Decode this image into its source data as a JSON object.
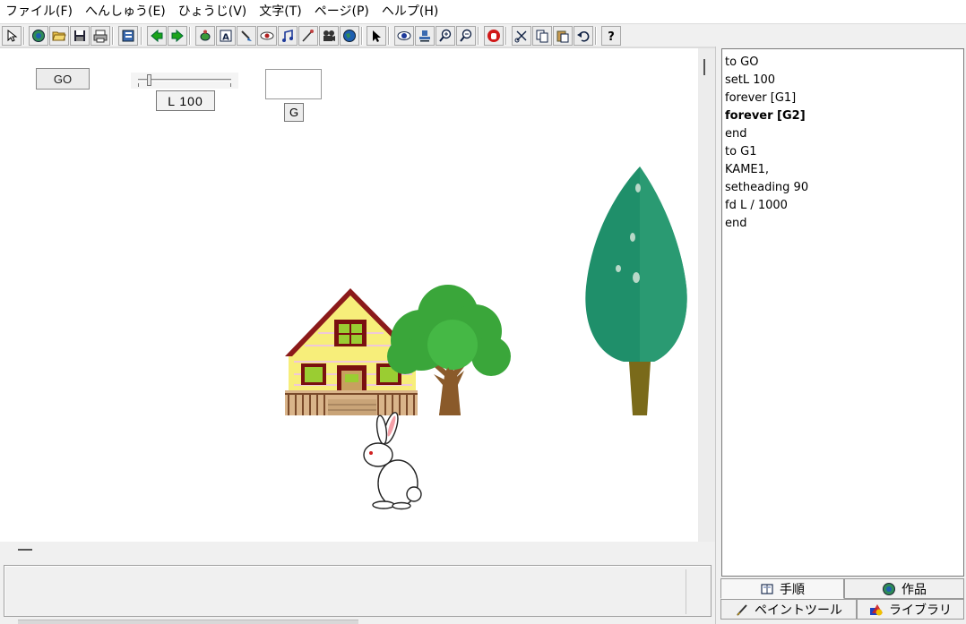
{
  "menu": [
    "ファイル(F)",
    "へんしゅう(E)",
    "ひょうじ(V)",
    "文字(T)",
    "ページ(P)",
    "ヘルプ(H)"
  ],
  "toolbar_icons": [
    "cursor-small-icon",
    "globe-icon",
    "open-folder-icon",
    "save-icon",
    "print-icon",
    "book-icon",
    "arrow-left-icon",
    "arrow-right-icon",
    "turtle-icon",
    "text-box-icon",
    "brush-icon",
    "eye-shape-icon",
    "music-note-icon",
    "slider-tool-icon",
    "movie-camera-icon",
    "earth-icon",
    "pointer-icon",
    "eye-icon",
    "stamp-icon",
    "zoom-in-icon",
    "zoom-out-icon",
    "stop-hand-icon",
    "cut-icon",
    "copy-icon",
    "paste-icon",
    "undo-icon",
    "help-icon"
  ],
  "page": {
    "go_button": "GO",
    "slider_label": "L   100",
    "slider_value_percent": 12,
    "g_button": "G",
    "text_box_value": ""
  },
  "code": {
    "lines": [
      {
        "text": "to GO",
        "bold": false
      },
      {
        "text": "setL 100",
        "bold": false
      },
      {
        "text": "forever [G1]",
        "bold": false
      },
      {
        "text": "forever [G2]",
        "bold": true
      },
      {
        "text": "end",
        "bold": false
      },
      {
        "text": "to G1",
        "bold": false
      },
      {
        "text": "KAME1,",
        "bold": false
      },
      {
        "text": "setheading 90",
        "bold": false
      },
      {
        "text": "fd L / 1000",
        "bold": false
      },
      {
        "text": "end",
        "bold": false
      }
    ]
  },
  "tabs": {
    "procedure": "手順",
    "works": "作品",
    "paint_tool": "ペイントツール",
    "library": "ライブラリ"
  },
  "status": {
    "text": ""
  },
  "colors": {
    "house_wall": "#f7ee7a",
    "house_roof": "#8b1a1a",
    "tree_green": "#3aa63a",
    "cypress_green": "#1f8f6a",
    "trunk": "#8a5a2a"
  }
}
